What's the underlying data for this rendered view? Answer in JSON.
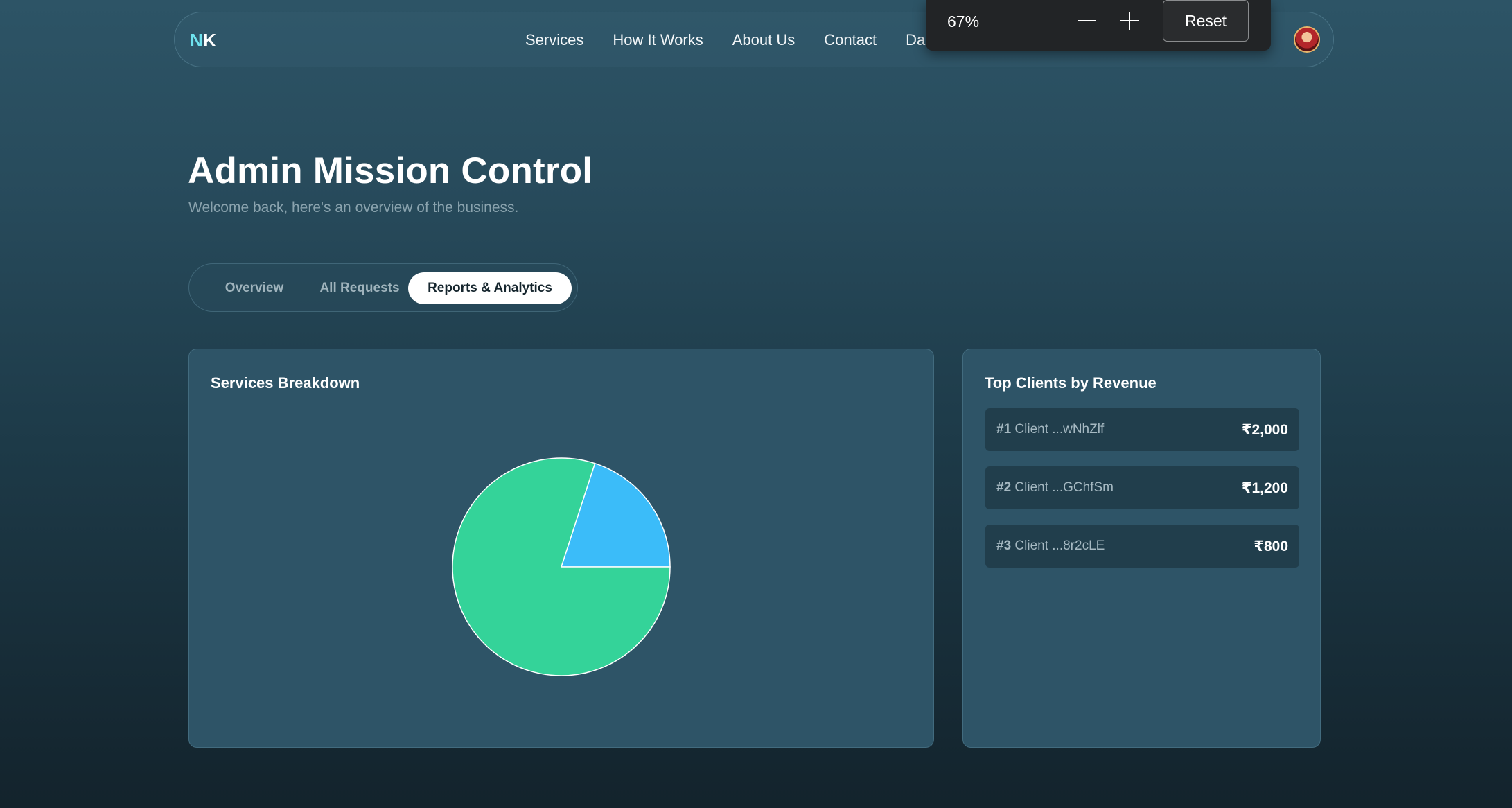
{
  "nav": {
    "logo_first": "N",
    "logo_second": "K",
    "links": [
      "Services",
      "How It Works",
      "About Us",
      "Contact",
      "Da"
    ]
  },
  "zoom_popup": {
    "level": "67%",
    "minus_icon": "minus-icon",
    "plus_icon": "plus-icon",
    "reset_label": "Reset"
  },
  "header": {
    "title": "Admin Mission Control",
    "subtitle": "Welcome back, here's an overview of the business."
  },
  "tabs": [
    {
      "label": "Overview",
      "active": false
    },
    {
      "label": "All Requests",
      "active": false
    },
    {
      "label": "Reports & Analytics",
      "active": true
    }
  ],
  "services_card": {
    "title": "Services Breakdown"
  },
  "chart_data": {
    "type": "pie",
    "title": "Services Breakdown",
    "slices": [
      {
        "value": 20,
        "color": "#3bbcf9"
      },
      {
        "value": 80,
        "color": "#34d399"
      }
    ],
    "legend": "none"
  },
  "clients_card": {
    "title": "Top Clients by Revenue",
    "clients": [
      {
        "rank": "#1",
        "name": "Client ...wNhZlf",
        "amount": "₹2,000"
      },
      {
        "rank": "#2",
        "name": "Client ...GChfSm",
        "amount": "₹1,200"
      },
      {
        "rank": "#3",
        "name": "Client ...8r2cLE",
        "amount": "₹800"
      }
    ]
  },
  "colors": {
    "accent": "#6fe3ef",
    "pie_blue": "#3bbcf9",
    "pie_green": "#34d399"
  }
}
